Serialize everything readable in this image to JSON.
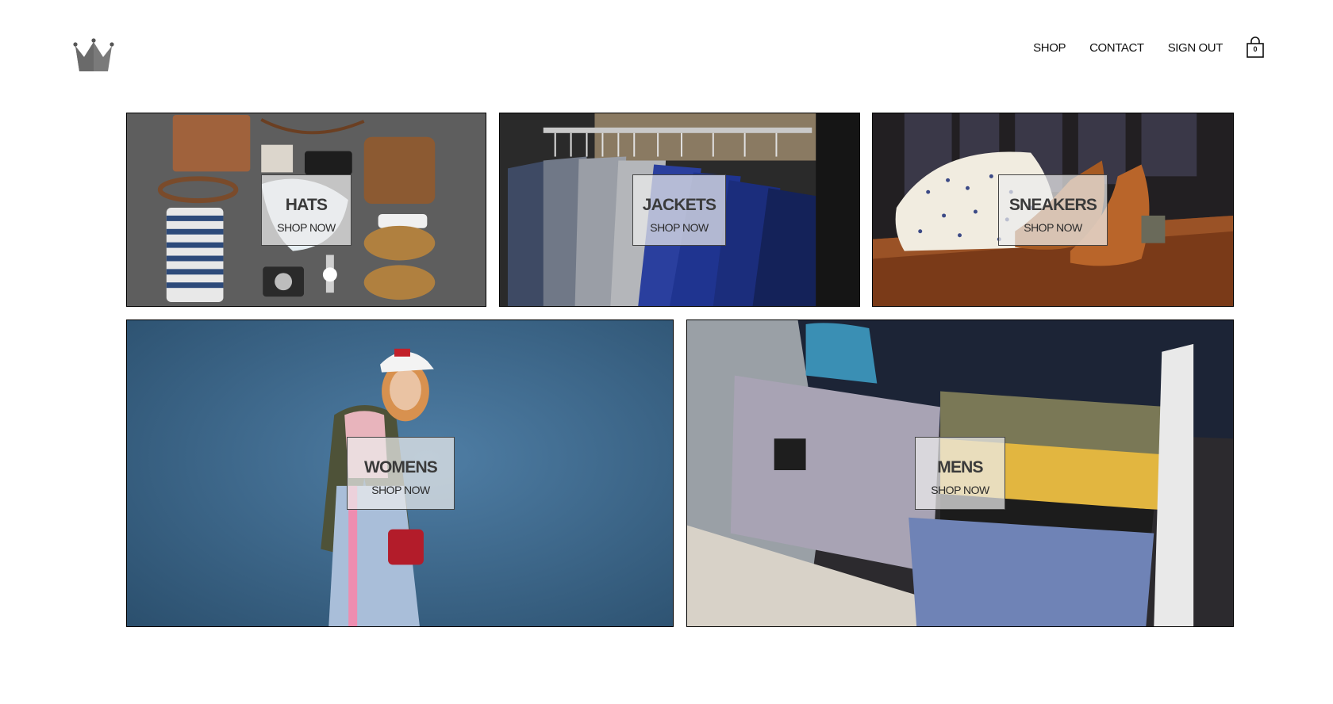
{
  "nav": {
    "links": [
      "SHOP",
      "CONTACT",
      "SIGN OUT"
    ],
    "cart_count": "0"
  },
  "icons": {
    "logo": "crown-icon",
    "cart": "shopping-bag-icon"
  },
  "categories": [
    {
      "title": "HATS",
      "cta": "SHOP NOW"
    },
    {
      "title": "JACKETS",
      "cta": "SHOP NOW"
    },
    {
      "title": "SNEAKERS",
      "cta": "SHOP NOW"
    },
    {
      "title": "WOMENS",
      "cta": "SHOP NOW"
    },
    {
      "title": "MENS",
      "cta": "SHOP NOW"
    }
  ]
}
